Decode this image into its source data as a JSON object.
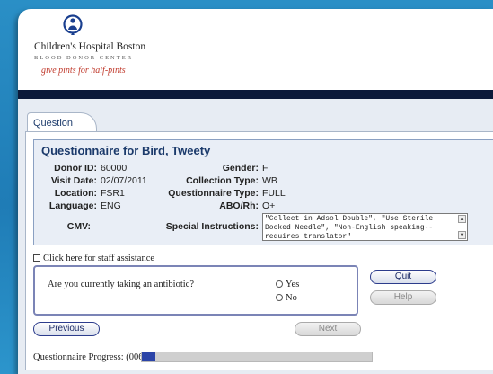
{
  "header": {
    "org_name": "Children's Hospital Boston",
    "org_subtitle": "BLOOD DONOR CENTER",
    "tagline": "give pints for half-pints"
  },
  "tab": {
    "label": "Question"
  },
  "donor_info": {
    "title": "Questionnaire for  Bird, Tweety",
    "donor_id": {
      "label": "Donor ID:",
      "value": "60000"
    },
    "visit_date": {
      "label": "Visit Date:",
      "value": "02/07/2011"
    },
    "location": {
      "label": "Location:",
      "value": "FSR1"
    },
    "language": {
      "label": "Language:",
      "value": "ENG"
    },
    "cmv": {
      "label": "CMV:",
      "value": ""
    },
    "gender": {
      "label": "Gender:",
      "value": "F"
    },
    "collection_type": {
      "label": "Collection Type:",
      "value": "WB"
    },
    "questionnaire_type": {
      "label": "Questionnaire Type:",
      "value": "FULL"
    },
    "abo_rh": {
      "label": "ABO/Rh:",
      "value": "O+"
    },
    "special_instructions": {
      "label": "Special Instructions:",
      "value": "\"Collect in Adsol Double\", \"Use Sterile Docked Needle\", \"Non-English speaking--requires translator\""
    }
  },
  "staff_assistance": {
    "label": "Click here for staff assistance",
    "checked": false
  },
  "question": {
    "text": "Are you currently taking an antibiotic?",
    "options": [
      "Yes",
      "No"
    ]
  },
  "buttons": {
    "quit": "Quit",
    "help": "Help",
    "previous": "Previous",
    "next": "Next"
  },
  "progress": {
    "label": "Questionnaire Progress: (006%):",
    "fraction": 0.06
  },
  "colors": {
    "frame_blue": "#1f7cb6",
    "navbar": "#0c1a3a",
    "heading_blue": "#1b3a6b",
    "progress_fill": "#2b44a8",
    "tagline_red": "#c0392b"
  }
}
